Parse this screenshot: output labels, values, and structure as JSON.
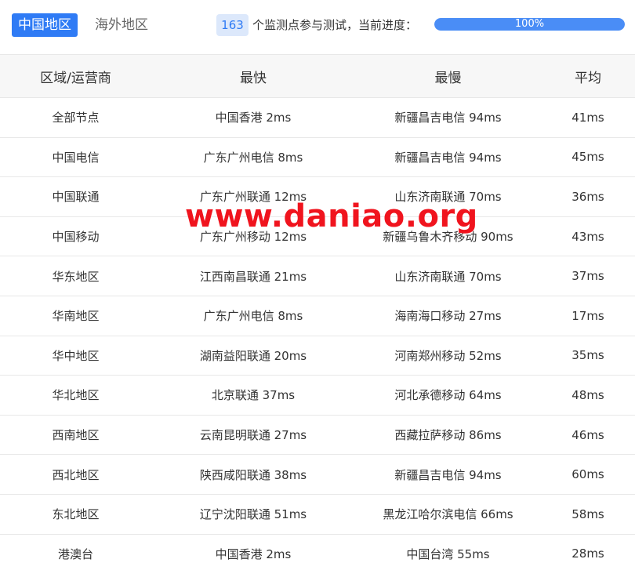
{
  "tabs": {
    "active": "中国地区",
    "inactive": "海外地区"
  },
  "summary": {
    "count": "163",
    "text": "个监测点参与测试，当前进度：",
    "progress_label": "100%",
    "progress_fraction": 1.0
  },
  "table": {
    "headers": [
      "区域/运营商",
      "最快",
      "最慢",
      "平均"
    ],
    "rows": [
      [
        "全部节点",
        "中国香港 2ms",
        "新疆昌吉电信 94ms",
        "41ms"
      ],
      [
        "中国电信",
        "广东广州电信 8ms",
        "新疆昌吉电信 94ms",
        "45ms"
      ],
      [
        "中国联通",
        "广东广州联通 12ms",
        "山东济南联通 70ms",
        "36ms"
      ],
      [
        "中国移动",
        "广东广州移动 12ms",
        "新疆乌鲁木齐移动 90ms",
        "43ms"
      ],
      [
        "华东地区",
        "江西南昌联通 21ms",
        "山东济南联通 70ms",
        "37ms"
      ],
      [
        "华南地区",
        "广东广州电信 8ms",
        "海南海口移动 27ms",
        "17ms"
      ],
      [
        "华中地区",
        "湖南益阳联通 20ms",
        "河南郑州移动 52ms",
        "35ms"
      ],
      [
        "华北地区",
        "北京联通 37ms",
        "河北承德移动 64ms",
        "48ms"
      ],
      [
        "西南地区",
        "云南昆明联通 27ms",
        "西藏拉萨移动 86ms",
        "46ms"
      ],
      [
        "西北地区",
        "陕西咸阳联通 38ms",
        "新疆昌吉电信 94ms",
        "60ms"
      ],
      [
        "东北地区",
        "辽宁沈阳联通 51ms",
        "黑龙江哈尔滨电信 66ms",
        "58ms"
      ],
      [
        "港澳台",
        "中国香港 2ms",
        "中国台湾 55ms",
        "28ms"
      ]
    ]
  },
  "watermark": "www.daniao.org",
  "colors": {
    "accent": "#2f7bf5",
    "progress": "#4a8df6",
    "watermark": "#f0141e"
  }
}
